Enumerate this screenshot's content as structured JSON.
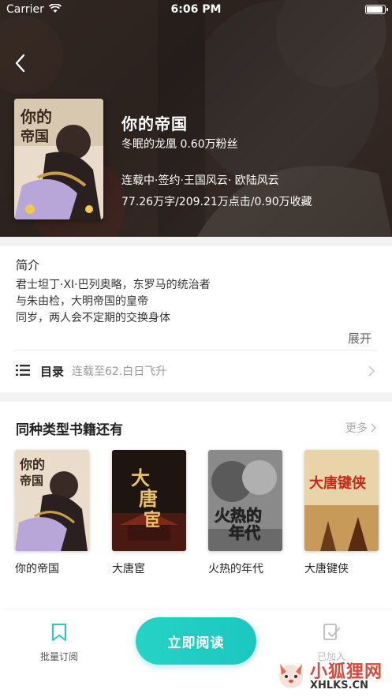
{
  "status_bar": {
    "carrier": "Carrier",
    "time": "6:06 PM"
  },
  "book": {
    "title": "你的帝国",
    "author_fans": "冬眠的龙凰 0.60万粉丝",
    "tags": "连载中·签约·王国风云· 欧陆风云",
    "stats": "77.26万字/209.21万点击/0.90万收藏"
  },
  "intro": {
    "heading": "简介",
    "lines": [
      "君士坦丁·XI·巴列奥略，东罗马的统治者",
      "与朱由检，大明帝国的皇帝",
      "同岁，两人会不定期的交换身体"
    ],
    "expand_label": "展开"
  },
  "toc": {
    "label": "目录",
    "status": "连载至62.白日飞升"
  },
  "similar": {
    "heading": "同种类型书籍还有",
    "more_label": "更多",
    "books": [
      {
        "name": "你的帝国",
        "cover_text": "你的帝国"
      },
      {
        "name": "大唐宦",
        "cover_text": "大唐宦"
      },
      {
        "name": "火热的年代",
        "cover_text": "火热的年代"
      },
      {
        "name": "大唐键侠",
        "cover_text": "大唐键侠"
      }
    ]
  },
  "bottom_bar": {
    "subscribe_label": "批量订阅",
    "read_label": "立即阅读",
    "shelf_label": "已加入"
  },
  "watermark": {
    "cn": "小狐狸网",
    "en": "XHLKS.CN"
  },
  "colors": {
    "accent": "#1fcac2",
    "hero_bg": "#2f2a28",
    "muted": "#999999"
  }
}
